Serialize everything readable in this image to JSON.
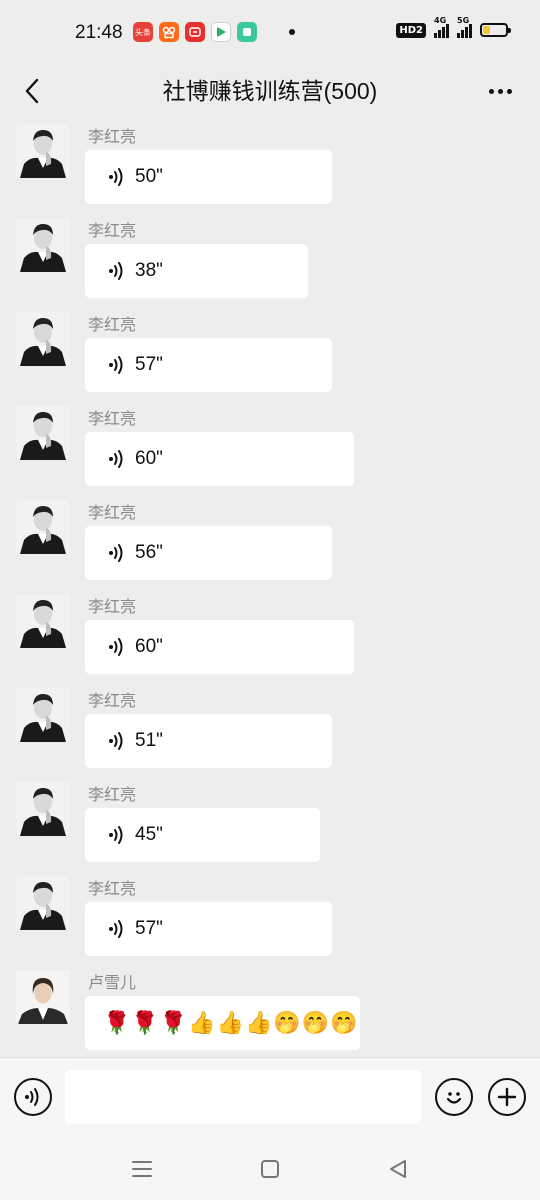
{
  "status_bar": {
    "time": "21:48",
    "apps": [
      {
        "name": "toutiao-app-icon",
        "label": "头条",
        "color": "#e8403a"
      },
      {
        "name": "kuaishou-app-icon",
        "label": "",
        "color": "#ff6a1a"
      },
      {
        "name": "pinduoduo-app-icon",
        "label": "",
        "color": "#e5322d"
      },
      {
        "name": "tencent-video-app-icon",
        "label": "",
        "color": "#31b24a"
      },
      {
        "name": "app-icon-green",
        "label": "",
        "color": "#3cc79d"
      }
    ],
    "hd_label": "HD2",
    "signal_1_label": "4G",
    "signal_2_label": "5G",
    "battery_level": 0.3
  },
  "header": {
    "title": "社博赚钱训练营(500)"
  },
  "messages": [
    {
      "sender": "李红亮",
      "type": "voice",
      "duration": "50\""
    },
    {
      "sender": "李红亮",
      "type": "voice",
      "duration": "38\""
    },
    {
      "sender": "李红亮",
      "type": "voice",
      "duration": "57\""
    },
    {
      "sender": "李红亮",
      "type": "voice",
      "duration": "60\""
    },
    {
      "sender": "李红亮",
      "type": "voice",
      "duration": "56\""
    },
    {
      "sender": "李红亮",
      "type": "voice",
      "duration": "60\""
    },
    {
      "sender": "李红亮",
      "type": "voice",
      "duration": "51\""
    },
    {
      "sender": "李红亮",
      "type": "voice",
      "duration": "45\""
    },
    {
      "sender": "李红亮",
      "type": "voice",
      "duration": "57\""
    },
    {
      "sender": "卢雪儿",
      "type": "text",
      "text": "🌹🌹🌹👍👍👍🤭🤭🤭"
    }
  ],
  "input": {
    "placeholder": ""
  }
}
